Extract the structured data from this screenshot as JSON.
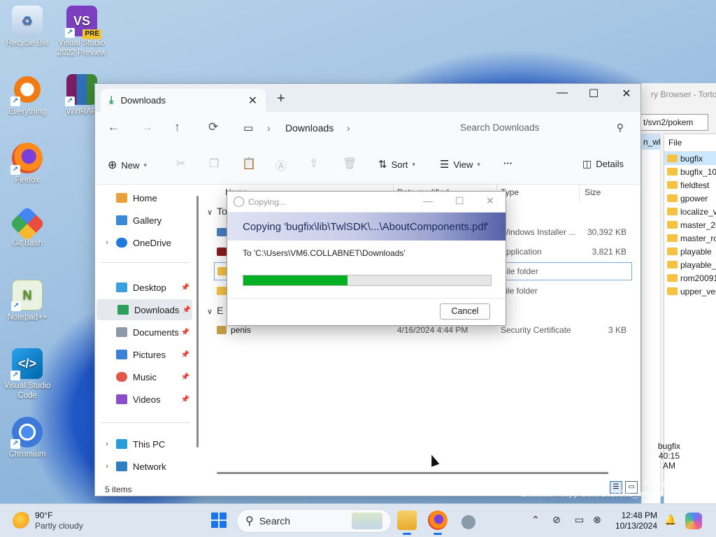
{
  "desktop": {
    "icons": [
      {
        "label": "Recycle Bin",
        "icon": "recycle-bin-icon"
      },
      {
        "label": "Visual Studio 2022 Preview",
        "icon": "visual-studio-icon",
        "badge": "PRE"
      },
      {
        "label": "Everything",
        "icon": "everything-icon"
      },
      {
        "label": "WinRAR",
        "icon": "winrar-icon"
      },
      {
        "label": "Firefox",
        "icon": "firefox-icon"
      },
      {
        "label": "Git Bash",
        "icon": "git-bash-icon"
      },
      {
        "label": "Notepad++",
        "icon": "notepadpp-icon"
      },
      {
        "label": "Visual Studio Code",
        "icon": "vscode-icon"
      },
      {
        "label": "Chromium",
        "icon": "chromium-icon"
      }
    ]
  },
  "tortoise": {
    "title": "ry Browser - Tortoise",
    "path": "t/svn2/pokem",
    "left_items": [
      "n_wl"
    ],
    "file_header": "File",
    "files": [
      "bugfix",
      "bugfix_10",
      "fieldtest",
      "gpower",
      "localize_v",
      "master_2r",
      "master_ro",
      "playable",
      "playable_",
      "rom20091",
      "upper_ver"
    ],
    "bottom_name": "bugfix",
    "bottom_time": "40:15 AM"
  },
  "explorer": {
    "tab_label": "Downloads",
    "tab_close": "✕",
    "new_tab": "+",
    "window_controls": {
      "minimize": "—",
      "maximize": "☐",
      "close": "✕"
    },
    "breadcrumb": [
      "Downloads"
    ],
    "search_placeholder": "Search Downloads",
    "toolbar": {
      "new_label": "New",
      "sort_label": "Sort",
      "view_label": "View",
      "more_label": "···",
      "details_label": "Details"
    },
    "nav": {
      "home": "Home",
      "gallery": "Gallery",
      "onedrive": "OneDrive",
      "desktop": "Desktop",
      "downloads": "Downloads",
      "documents": "Documents",
      "pictures": "Pictures",
      "music": "Music",
      "videos": "Videos",
      "thispc": "This PC",
      "network": "Network"
    },
    "columns": {
      "name": "Name",
      "date": "Date modified",
      "type": "Type",
      "size": "Size"
    },
    "groups": {
      "today": "To",
      "earlier": "E"
    },
    "rows": [
      {
        "type": "Windows Installer ...",
        "size": "30,392 KB",
        "color": "#4a7fc1"
      },
      {
        "type": "Application",
        "size": "3,821 KB",
        "color": "#8b1d1d"
      },
      {
        "type": "File folder",
        "size": "",
        "color": "#f5c243"
      },
      {
        "type": "File folder",
        "size": "",
        "color": "#f5c243"
      },
      {
        "name": "penis",
        "date": "4/16/2024 4:44 PM",
        "type": "Security Certificate",
        "size": "3 KB",
        "color": "#c9a24a"
      }
    ],
    "status": "5 items"
  },
  "copy_dialog": {
    "title": "Copying...",
    "heading": "Copying 'bugfix\\lib\\TwlSDK\\...\\AboutComponents.pdf'",
    "destination": "To 'C:\\Users\\VM6.COLLABNET\\Downloads'",
    "progress": 0.42,
    "cancel_label": "Cancel",
    "progress_color": "#06b025"
  },
  "taskbar": {
    "temp": "90°F",
    "condition": "Partly cloudy",
    "search_label": "Search",
    "time": "12:48 PM",
    "date": "10/13/2024"
  },
  "watermark": {
    "line1": "Pro Insider Preview",
    "line2": "Evaluation copy. Build 26100.rs_release.240308-1400"
  }
}
